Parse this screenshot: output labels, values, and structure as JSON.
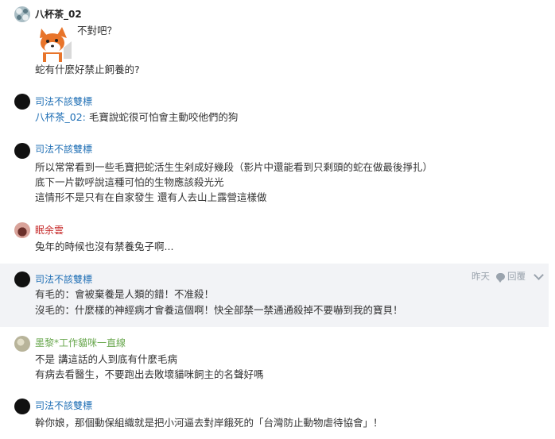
{
  "comments": [
    {
      "author": "八杯茶_02",
      "sticker_text": "不對吧？",
      "lines": [
        "蛇有什麼好禁止飼養的?"
      ]
    },
    {
      "author": "司法不該雙標",
      "reply_to": "八杯茶_02:",
      "lines": [
        "毛寶說蛇很可怕會主動咬他們的狗"
      ]
    },
    {
      "author": "司法不該雙標",
      "lines": [
        "所以常常看到一些毛寶把蛇活生生剁成好幾段（影片中還能看到只剩頭的蛇在做最後掙扎）",
        "底下一片歡呼說這種可怕的生物應該殺光光",
        "這情形不是只有在自家發生 還有人去山上露營這樣做"
      ]
    },
    {
      "author": "眠余雲",
      "lines": [
        "兔年的時候也沒有禁養兔子啊..."
      ]
    },
    {
      "author": "司法不該雙標",
      "time": "昨天",
      "reply_label": "回覆",
      "lines": [
        "有毛的：會被棄養是人類的錯！不准殺！",
        "沒毛的：什麼樣的神經病才會養這個啊！快全部禁一禁通通殺掉不要嚇到我的寶貝！"
      ]
    },
    {
      "author": "墨黎*工作貓咪一直線",
      "lines": [
        "不是 講這話的人到底有什麼毛病",
        "有病去看醫生，不要跑出去敗壞貓咪飼主的名聲好嗎"
      ]
    },
    {
      "author": "司法不該雙標",
      "lines": [
        "幹你娘，那個動保組織就是把小河逼去對岸餓死的「台灣防止動物虐待協會」！"
      ]
    }
  ]
}
